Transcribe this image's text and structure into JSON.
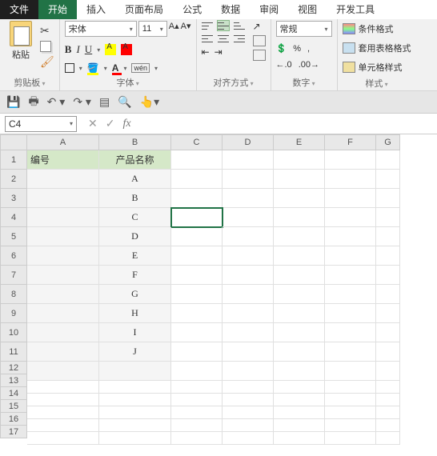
{
  "tabs": {
    "file": "文件",
    "home": "开始",
    "insert": "插入",
    "layout": "页面布局",
    "formula": "公式",
    "data": "数据",
    "review": "审阅",
    "view": "视图",
    "dev": "开发工具"
  },
  "ribbon": {
    "clipboard": {
      "label": "剪贴板",
      "paste": "粘贴"
    },
    "font": {
      "label": "字体",
      "name": "宋体",
      "size": "11",
      "wen": "wén"
    },
    "align": {
      "label": "对齐方式"
    },
    "number": {
      "label": "数字",
      "format": "常规",
      "percent": "%",
      "comma": ",",
      "inc": ".0",
      "dec": ".00"
    },
    "style": {
      "label": "样式",
      "cond": "条件格式",
      "table": "套用表格格式",
      "cell": "单元格样式"
    }
  },
  "namebox": "C4",
  "columns": [
    "A",
    "B",
    "C",
    "D",
    "E",
    "F",
    "G"
  ],
  "rows": [
    "1",
    "2",
    "3",
    "4",
    "5",
    "6",
    "7",
    "8",
    "9",
    "10",
    "11",
    "12",
    "13",
    "14",
    "15",
    "16",
    "17"
  ],
  "sheet": {
    "header": {
      "a": "编号",
      "b": "产品名称"
    },
    "products": [
      "A",
      "B",
      "C",
      "D",
      "E",
      "F",
      "G",
      "H",
      "I",
      "J"
    ]
  },
  "chart_data": {
    "type": "table",
    "columns": [
      "编号",
      "产品名称"
    ],
    "rows": [
      [
        "",
        "A"
      ],
      [
        "",
        "B"
      ],
      [
        "",
        "C"
      ],
      [
        "",
        "D"
      ],
      [
        "",
        "E"
      ],
      [
        "",
        "F"
      ],
      [
        "",
        "G"
      ],
      [
        "",
        "H"
      ],
      [
        "",
        "I"
      ],
      [
        "",
        "J"
      ]
    ]
  }
}
